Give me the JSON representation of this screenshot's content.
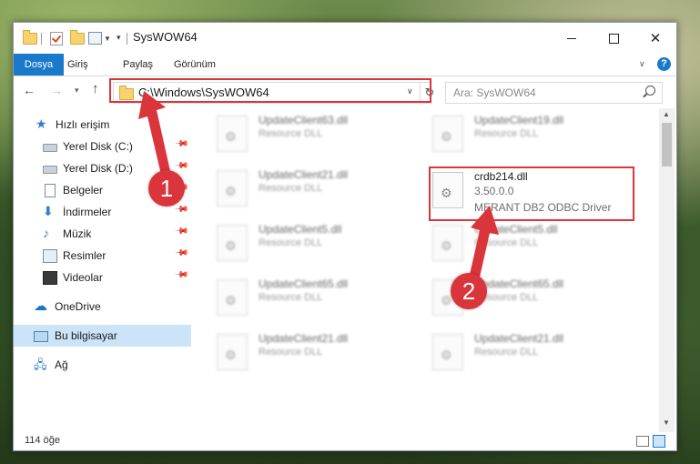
{
  "window": {
    "title": "SysWOW64"
  },
  "ribbon": {
    "tabs": [
      "Dosya",
      "Giriş",
      "Paylaş",
      "Görünüm"
    ]
  },
  "navigation": {
    "address": "C:\\Windows\\SysWOW64",
    "search_placeholder": "Ara: SysWOW64"
  },
  "sidebar": {
    "quick_access": "Hızlı erişim",
    "items": [
      {
        "label": "Yerel Disk (C:)",
        "icon": "disk-icon",
        "pinned": true
      },
      {
        "label": "Yerel Disk (D:)",
        "icon": "disk-icon",
        "pinned": true
      },
      {
        "label": "Belgeler",
        "icon": "documents-icon",
        "pinned": true
      },
      {
        "label": "İndirmeler",
        "icon": "downloads-icon",
        "pinned": true
      },
      {
        "label": "Müzik",
        "icon": "music-icon",
        "pinned": true
      },
      {
        "label": "Resimler",
        "icon": "pictures-icon",
        "pinned": true
      },
      {
        "label": "Videolar",
        "icon": "videos-icon",
        "pinned": true
      }
    ],
    "onedrive": "OneDrive",
    "this_pc": "Bu bilgisayar",
    "network": "Ağ"
  },
  "files": {
    "left_column": [
      {
        "name": "UpdateClient63.dll",
        "type": "Resource DLL"
      },
      {
        "name": "UpdateClient21.dll",
        "type": "Resource DLL"
      },
      {
        "name": "UpdateClient5.dll",
        "type": "Resource DLL"
      },
      {
        "name": "UpdateClient65.dll",
        "type": "Resource DLL"
      },
      {
        "name": "UpdateClient21.dll",
        "type": "Resource DLL"
      }
    ],
    "right_column": [
      {
        "name": "UpdateClient19.dll",
        "type": "Resource DLL"
      },
      {
        "name": "UpdateClient5.dll",
        "type": "Resource DLL"
      },
      {
        "name": "UpdateClient65.dll",
        "type": "Resource DLL"
      },
      {
        "name": "UpdateClient21.dll",
        "type": "Resource DLL"
      }
    ],
    "highlighted": {
      "name": "crdb214.dll",
      "version": "3.50.0.0",
      "description": "MERANT DB2 ODBC Driver"
    }
  },
  "status": {
    "item_count": "114 öğe"
  },
  "annotations": {
    "step1": "1",
    "step2": "2"
  }
}
